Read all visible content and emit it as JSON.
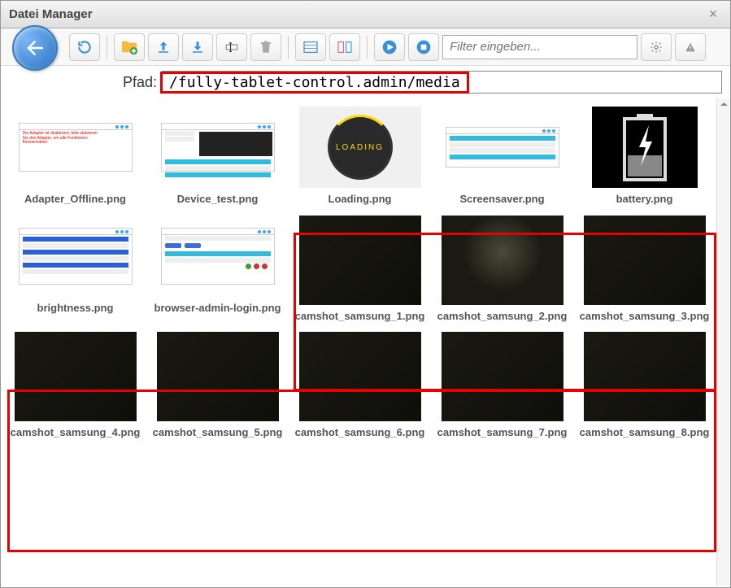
{
  "window": {
    "title": "Datei Manager"
  },
  "toolbar": {
    "filter_placeholder": "Filter eingeben..."
  },
  "path": {
    "label": "Pfad:",
    "value": "/fully-tablet-control.admin/media/"
  },
  "files": [
    {
      "name": "Adapter_Offline.png",
      "kind": "adapter"
    },
    {
      "name": "Device_test.png",
      "kind": "device"
    },
    {
      "name": "Loading.png",
      "kind": "loading",
      "loading_text": "LOADING"
    },
    {
      "name": "Screensaver.png",
      "kind": "screensaver"
    },
    {
      "name": "battery.png",
      "kind": "battery"
    },
    {
      "name": "brightness.png",
      "kind": "brightness"
    },
    {
      "name": "browser-admin-login.png",
      "kind": "browser-login"
    },
    {
      "name": "camshot_samsung_1.png",
      "kind": "dark"
    },
    {
      "name": "camshot_samsung_2.png",
      "kind": "dark-blur"
    },
    {
      "name": "camshot_samsung_3.png",
      "kind": "dark"
    },
    {
      "name": "camshot_samsung_4.png",
      "kind": "dark"
    },
    {
      "name": "camshot_samsung_5.png",
      "kind": "dark"
    },
    {
      "name": "camshot_samsung_6.png",
      "kind": "dark"
    },
    {
      "name": "camshot_samsung_7.png",
      "kind": "dark"
    },
    {
      "name": "camshot_samsung_8.png",
      "kind": "dark"
    }
  ],
  "annotations": {
    "highlight_path": true,
    "highlight_camshots": true
  }
}
